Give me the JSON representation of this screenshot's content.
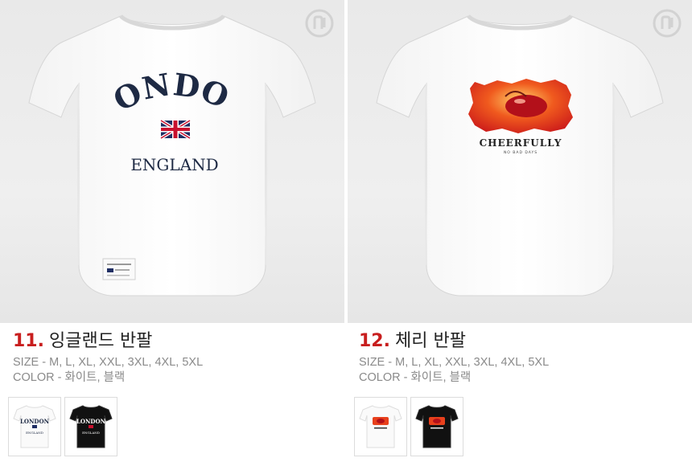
{
  "products": [
    {
      "number": "11.",
      "name": "잉글랜드 반팔",
      "size": "SIZE - M, L, XL, XXL, 3XL, 4XL, 5XL",
      "color": "COLOR - 화이트, 블랙",
      "print_main": "LONDON",
      "print_sub": "ENGLAND",
      "thumbs": [
        "white",
        "black"
      ]
    },
    {
      "number": "12.",
      "name": "체리 반팔",
      "size": "SIZE - M, L, XL, XXL, 3XL, 4XL, 5XL",
      "color": "COLOR - 화이트, 블랙",
      "print_main": "CHEERFULLY",
      "print_sub": "NO BAD DAYS",
      "thumbs": [
        "white",
        "black"
      ]
    }
  ],
  "colors": {
    "accent_red": "#c81e1e",
    "navy": "#1e2a44",
    "panel_bg": "#eeeeee"
  },
  "icons": {
    "brand": "brand-logo-icon",
    "flag": "union-jack-icon"
  }
}
